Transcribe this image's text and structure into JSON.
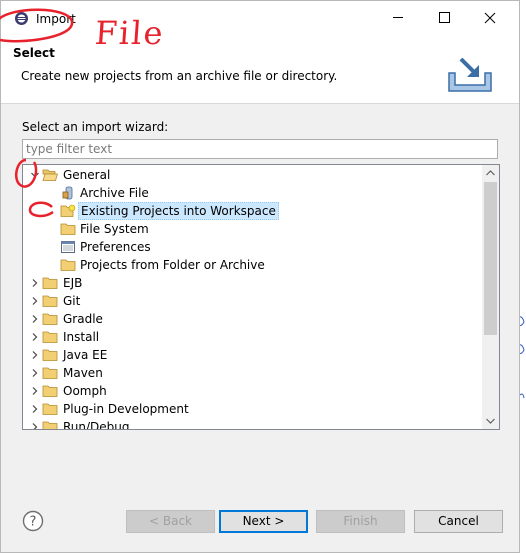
{
  "window": {
    "title": "Import",
    "controls": {
      "minimize_icon": "minimize-icon",
      "maximize_icon": "maximize-icon",
      "close_icon": "close-icon"
    }
  },
  "header": {
    "title": "Select",
    "description": "Create new projects from an archive file or directory.",
    "banner_icon": "import-wizard-banner-icon"
  },
  "wizard": {
    "label": "Select an import wizard:",
    "filter_placeholder": "type filter text",
    "filter_value": ""
  },
  "tree": {
    "items": [
      {
        "label": "General",
        "expanded": true,
        "depth": 0,
        "icon": "folder-open-icon"
      },
      {
        "label": "Archive File",
        "depth": 1,
        "icon": "archive-file-icon"
      },
      {
        "label": "Existing Projects into Workspace",
        "depth": 1,
        "icon": "existing-project-icon",
        "selected": true
      },
      {
        "label": "File System",
        "depth": 1,
        "icon": "folder-icon"
      },
      {
        "label": "Preferences",
        "depth": 1,
        "icon": "preferences-icon"
      },
      {
        "label": "Projects from Folder or Archive",
        "depth": 1,
        "icon": "folder-icon"
      },
      {
        "label": "EJB",
        "depth": 0,
        "icon": "folder-icon"
      },
      {
        "label": "Git",
        "depth": 0,
        "icon": "folder-icon"
      },
      {
        "label": "Gradle",
        "depth": 0,
        "icon": "folder-icon"
      },
      {
        "label": "Install",
        "depth": 0,
        "icon": "folder-icon"
      },
      {
        "label": "Java EE",
        "depth": 0,
        "icon": "folder-icon"
      },
      {
        "label": "Maven",
        "depth": 0,
        "icon": "folder-icon"
      },
      {
        "label": "Oomph",
        "depth": 0,
        "icon": "folder-icon"
      },
      {
        "label": "Plug-in Development",
        "depth": 0,
        "icon": "folder-icon"
      },
      {
        "label": "Run/Debug",
        "depth": 0,
        "icon": "folder-icon"
      }
    ]
  },
  "buttons": {
    "back": "< Back",
    "next": "Next >",
    "finish": "Finish",
    "cancel": "Cancel",
    "help_icon": "help-icon"
  },
  "annotation": {
    "text": "File",
    "color": "#e8222c"
  },
  "colors": {
    "selection": "#cce8ff",
    "default_button_border": "#0078d7",
    "annotation_red": "#e8222c",
    "annotation_blue": "#1c2fb8"
  }
}
